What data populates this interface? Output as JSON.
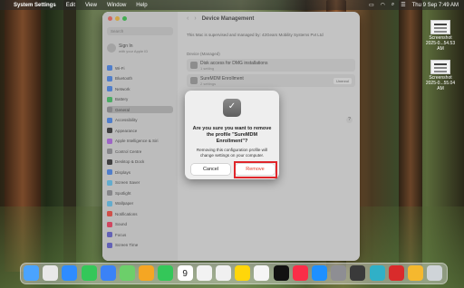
{
  "menubar": {
    "app": "System Settings",
    "items": [
      "Edit",
      "View",
      "Window",
      "Help"
    ],
    "datetime": "Thu 9 Sep 7:49 AM"
  },
  "desktop": {
    "files": [
      {
        "line1": "Screenshot",
        "line2": "2025-0...54.53 AM"
      },
      {
        "line1": "Screenshot",
        "line2": "2025-0...55.04 AM"
      }
    ]
  },
  "sidebar": {
    "search_placeholder": "Search",
    "signin_title": "Sign In",
    "signin_sub": "with your Apple ID",
    "items": [
      {
        "label": "Wi-Fi",
        "color": "#3b82f6"
      },
      {
        "label": "Bluetooth",
        "color": "#3b82f6"
      },
      {
        "label": "Network",
        "color": "#3b82f6"
      },
      {
        "label": "Battery",
        "color": "#34c759"
      },
      {
        "label": "General",
        "color": "#8e8e93"
      },
      {
        "label": "Accessibility",
        "color": "#3b82f6"
      },
      {
        "label": "Appearance",
        "color": "#222222"
      },
      {
        "label": "Apple Intelligence & Siri",
        "color": "#b35cf0"
      },
      {
        "label": "Control Centre",
        "color": "#8e8e93"
      },
      {
        "label": "Desktop & Dock",
        "color": "#222222"
      },
      {
        "label": "Displays",
        "color": "#3b82f6"
      },
      {
        "label": "Screen Saver",
        "color": "#5ac8fa"
      },
      {
        "label": "Spotlight",
        "color": "#8e8e93"
      },
      {
        "label": "Wallpaper",
        "color": "#5ac8fa"
      },
      {
        "label": "Notifications",
        "color": "#ff3b30"
      },
      {
        "label": "Sound",
        "color": "#ff2d55"
      },
      {
        "label": "Focus",
        "color": "#5856d6"
      },
      {
        "label": "Screen Time",
        "color": "#5856d6"
      }
    ]
  },
  "main": {
    "title": "Device Management",
    "supervised_text": "This Mac is supervised and managed by: 42Gears Mobility Systems Pvt Ltd",
    "section_label": "Device (Managed)",
    "profiles": [
      {
        "name": "Disk access for DMG installations",
        "sub": "1 setting",
        "button": ""
      },
      {
        "name": "SureMDM Enrollment",
        "sub": "2 settings",
        "button": "Unenrol"
      }
    ],
    "help": "?"
  },
  "dialog": {
    "title": "Are you sure you want to remove the profile \"SureMDM Enrollment\"?",
    "message": "Removing this configuration profile will change settings on your computer.",
    "cancel_label": "Cancel",
    "remove_label": "Remove"
  },
  "dock": {
    "icons": [
      {
        "name": "finder-icon",
        "color": "#4aa3ff"
      },
      {
        "name": "launchpad-icon",
        "color": "#e8e8e8"
      },
      {
        "name": "safari-icon",
        "color": "#2f8cff"
      },
      {
        "name": "messages-icon",
        "color": "#34c759"
      },
      {
        "name": "mail-icon",
        "color": "#3b82f6"
      },
      {
        "name": "maps-icon",
        "color": "#6ccf6a"
      },
      {
        "name": "photos-icon",
        "color": "#f5a623"
      },
      {
        "name": "facetime-icon",
        "color": "#34c759"
      },
      {
        "name": "calendar-icon",
        "color": "#ffffff"
      },
      {
        "name": "reminders-icon",
        "color": "#f2f2f2"
      },
      {
        "name": "freeform-icon",
        "color": "#f0f0f0"
      },
      {
        "name": "notes-icon",
        "color": "#ffd60a"
      },
      {
        "name": "keynote-icon",
        "color": "#f5f5f5"
      },
      {
        "name": "apple-tv-icon",
        "color": "#111111"
      },
      {
        "name": "music-icon",
        "color": "#fa2d48"
      },
      {
        "name": "app-store-icon",
        "color": "#1e90ff"
      },
      {
        "name": "system-settings-icon",
        "color": "#8e8e93"
      },
      {
        "name": "quicktime-icon",
        "color": "#3a3a3a"
      },
      {
        "name": "screen-share-icon",
        "color": "#30b0c7"
      },
      {
        "name": "network-app-icon",
        "color": "#d92b2b"
      },
      {
        "name": "archive-utility-icon",
        "color": "#f5b82e"
      },
      {
        "name": "trash-icon",
        "color": "#cfd4d8"
      }
    ],
    "calendar_day": "9"
  },
  "accent": {
    "highlight": "#e0262b",
    "remove_text": "#e0402f"
  }
}
